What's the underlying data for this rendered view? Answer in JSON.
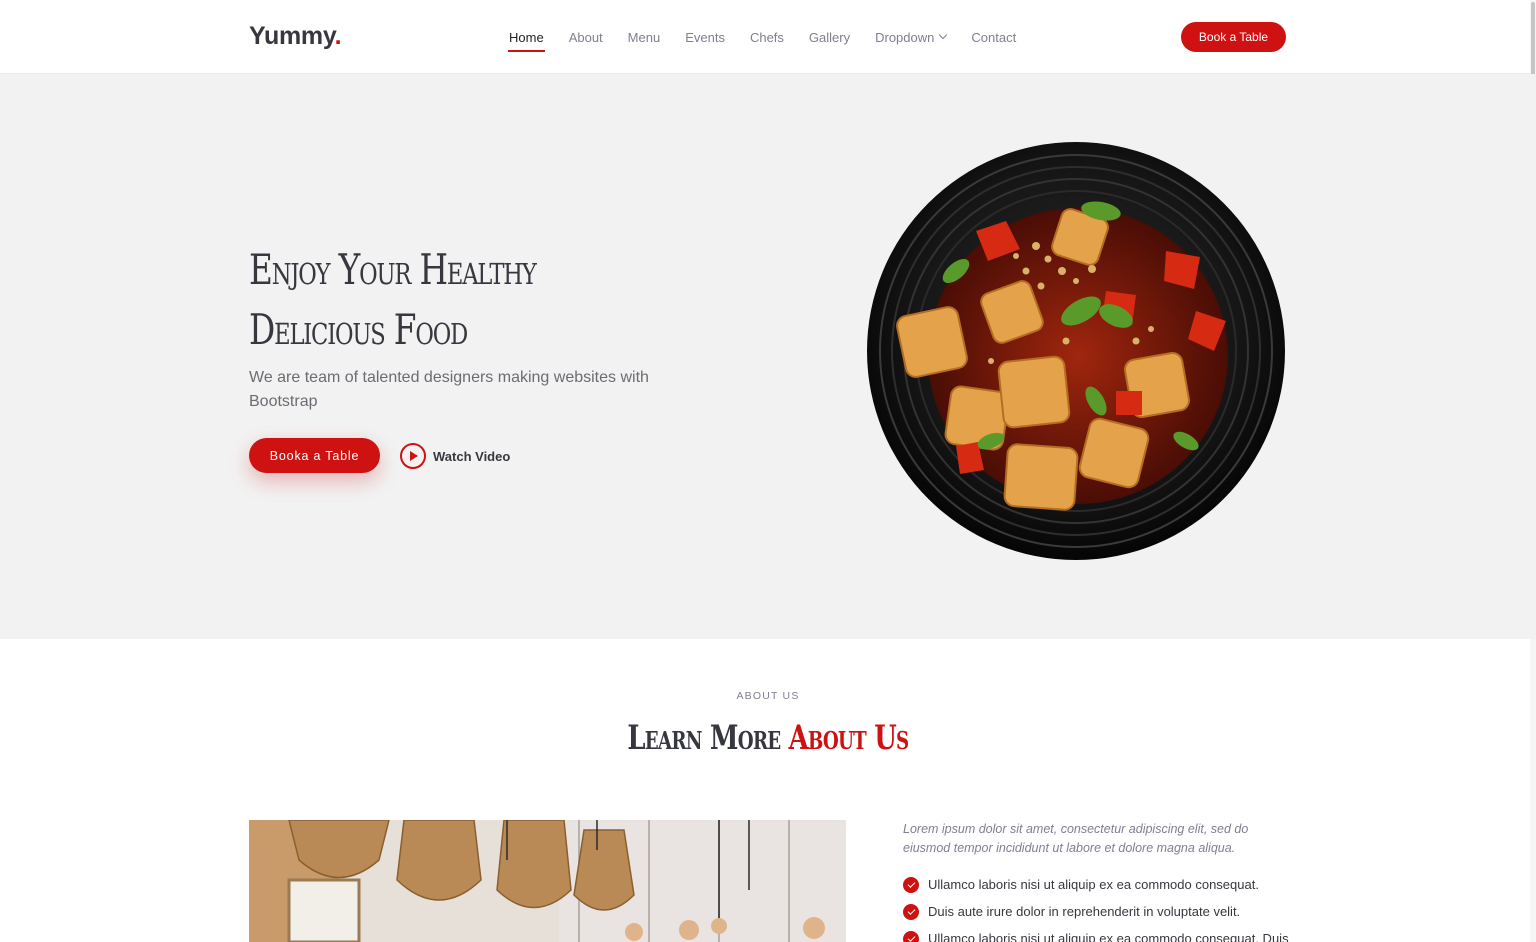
{
  "header": {
    "logo": "Yummy",
    "logo_dot": ".",
    "nav": [
      "Home",
      "About",
      "Menu",
      "Events",
      "Chefs",
      "Gallery",
      "Dropdown",
      "Contact"
    ],
    "active_nav": "Home",
    "cta_label": "Book a Table"
  },
  "hero": {
    "title_line1": "Enjoy Your Healthy",
    "title_line2": "Delicious Food",
    "description": "We are team of talented designers making websites with Bootstrap",
    "book_button": "Booka a Table",
    "watch_video": "Watch Video",
    "image_icon": "food-plate-image"
  },
  "about": {
    "eyebrow": "ABOUT US",
    "title_main": "Learn More",
    "title_accent": "About Us",
    "intro": "Lorem ipsum dolor sit amet, consectetur adipiscing elit, sed do eiusmod tempor incididunt ut labore et dolore magna aliqua.",
    "checklist": [
      "Ullamco laboris nisi ut aliquip ex ea commodo consequat.",
      "Duis aute irure dolor in reprehenderit in voluptate velit.",
      "Ullamco laboris nisi ut aliquip ex ea commodo consequat. Duis"
    ],
    "image_icon": "restaurant-interior-image"
  },
  "colors": {
    "accent": "#ce1212",
    "hero_bg": "#f2f2f2",
    "heading": "#37373f",
    "muted": "#7f7f90"
  }
}
